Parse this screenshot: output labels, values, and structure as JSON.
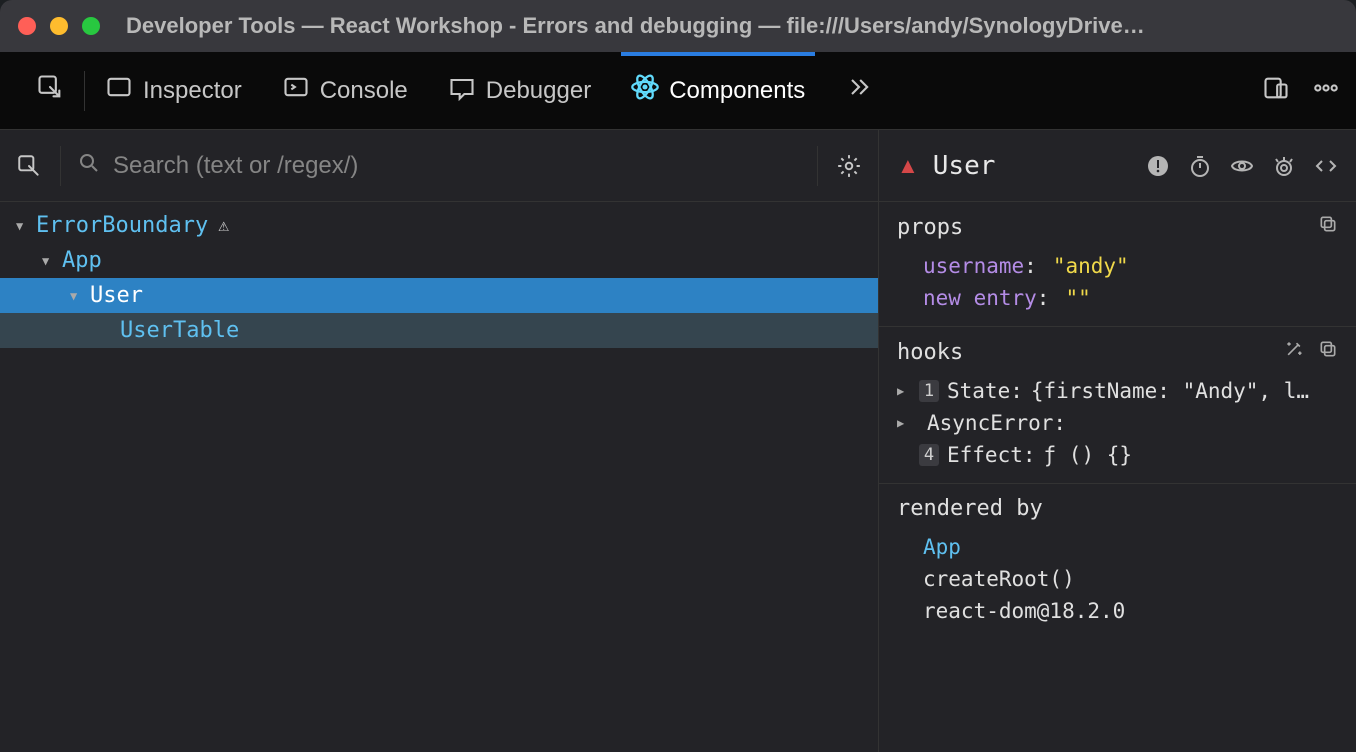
{
  "window": {
    "title": "Developer Tools — React Workshop - Errors and debugging — file:///Users/andy/SynologyDrive…"
  },
  "tabs": {
    "inspector": "Inspector",
    "console": "Console",
    "debugger": "Debugger",
    "components": "Components"
  },
  "search": {
    "placeholder": "Search (text or /regex/)"
  },
  "tree": [
    {
      "name": "ErrorBoundary",
      "depth": 0,
      "expanded": true,
      "warn": true,
      "selected": false
    },
    {
      "name": "App",
      "depth": 1,
      "expanded": true,
      "warn": false,
      "selected": false
    },
    {
      "name": "User",
      "depth": 2,
      "expanded": true,
      "warn": false,
      "selected": true
    },
    {
      "name": "UserTable",
      "depth": 3,
      "expanded": false,
      "warn": false,
      "hovered": true
    }
  ],
  "details": {
    "component_name": "User",
    "props": {
      "label": "props",
      "entries": [
        {
          "key": "username",
          "value": "\"andy\"",
          "type": "string"
        },
        {
          "key": "new entry",
          "value": "\"\"",
          "type": "string"
        }
      ]
    },
    "hooks": {
      "label": "hooks",
      "entries": [
        {
          "badge": "1",
          "name": "State",
          "value": "{firstName: \"Andy\", l…",
          "expandable": true
        },
        {
          "badge": "",
          "name": "AsyncError",
          "value": "",
          "expandable": true
        },
        {
          "badge": "4",
          "name": "Effect",
          "value": "ƒ () {}",
          "expandable": false
        }
      ]
    },
    "rendered_by": {
      "label": "rendered by",
      "entries": [
        {
          "text": "App",
          "link": true
        },
        {
          "text": "createRoot()",
          "link": false
        },
        {
          "text": "react-dom@18.2.0",
          "link": false
        }
      ]
    }
  }
}
